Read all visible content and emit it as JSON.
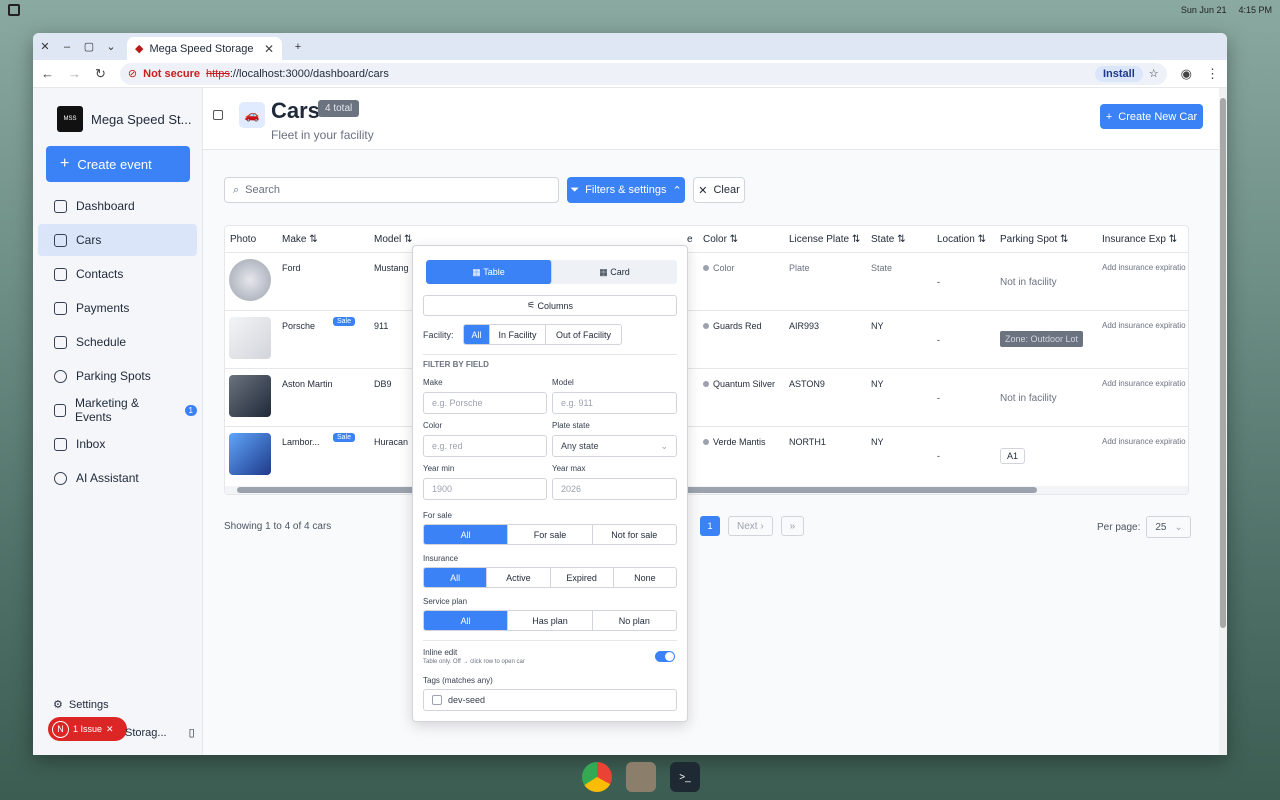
{
  "desktop": {
    "date": "Sun Jun 21",
    "time": "4:15 PM"
  },
  "browser": {
    "tab_title": "Mega Speed Storage",
    "not_secure": "Not secure",
    "url_scheme": "https",
    "url_rest": "://localhost:3000/dashboard/cars",
    "install": "Install"
  },
  "sidebar": {
    "brand": "Mega Speed St...",
    "create_event": "Create event",
    "items": [
      {
        "label": "Dashboard"
      },
      {
        "label": "Cars"
      },
      {
        "label": "Contacts"
      },
      {
        "label": "Payments"
      },
      {
        "label": "Schedule"
      },
      {
        "label": "Parking Spots"
      },
      {
        "label": "Marketing & Events",
        "badge": "1"
      },
      {
        "label": "Inbox"
      },
      {
        "label": "AI Assistant"
      }
    ],
    "settings": "Settings",
    "issue_initial": "N",
    "issue_label": "1 Issue",
    "footer_label": "Storag..."
  },
  "header": {
    "title": "Cars",
    "total": "4 total",
    "subtitle": "Fleet in your facility",
    "new_car": "Create New Car"
  },
  "toolbar": {
    "search_placeholder": "Search",
    "filters": "Filters & settings",
    "clear": "Clear"
  },
  "table": {
    "headers": {
      "photo": "Photo",
      "make": "Make",
      "model": "Model",
      "e": "e",
      "color": "Color",
      "plate": "License Plate",
      "state": "State",
      "location": "Location",
      "parking": "Parking Spot",
      "insurance": "Insurance Exp"
    },
    "sale_label": "Sale",
    "rows": [
      {
        "make": "Ford",
        "model": "Mustang",
        "color": "Color",
        "plate": "Plate",
        "state": "State",
        "location": "-",
        "parking": "Not in facility",
        "insurance": "Add insurance expiratio"
      },
      {
        "make": "Porsche",
        "model": "911",
        "color": "Guards Red",
        "plate": "AIR993",
        "state": "NY",
        "location": "-",
        "parking": "Zone: Outdoor Lot",
        "insurance": "Add insurance expiratio"
      },
      {
        "make": "Aston Martin",
        "model": "DB9",
        "color": "Quantum Silver",
        "plate": "ASTON9",
        "state": "NY",
        "location": "-",
        "parking": "Not in facility",
        "insurance": "Add insurance expiratio"
      },
      {
        "make": "Lambor...",
        "model": "Huracan",
        "color": "Verde Mantis",
        "plate": "NORTH1",
        "state": "NY",
        "location": "-",
        "parking": "A1",
        "insurance": "Add insurance expiratio"
      }
    ]
  },
  "footer": {
    "showing": "Showing 1 to 4 of 4 cars",
    "page": "1",
    "next": "Next",
    "per_page_label": "Per page:",
    "per_page": "25"
  },
  "panel": {
    "view_table": "Table",
    "view_card": "Card",
    "columns": "Columns",
    "facility_label": "Facility:",
    "facility_all": "All",
    "facility_in": "In Facility",
    "facility_out": "Out of Facility",
    "filter_by_field": "FILTER BY FIELD",
    "make_label": "Make",
    "make_ph": "e.g. Porsche",
    "model_label": "Model",
    "model_ph": "e.g. 911",
    "color_label": "Color",
    "color_ph": "e.g. red",
    "plate_state_label": "Plate state",
    "plate_state_value": "Any state",
    "year_min_label": "Year min",
    "year_min_ph": "1900",
    "year_max_label": "Year max",
    "year_max_ph": "2026",
    "for_sale_label": "For sale",
    "for_sale_opts": [
      "All",
      "For sale",
      "Not for sale"
    ],
    "insurance_label": "Insurance",
    "insurance_opts": [
      "All",
      "Active",
      "Expired",
      "None"
    ],
    "service_label": "Service plan",
    "service_opts": [
      "All",
      "Has plan",
      "No plan"
    ],
    "inline_edit": "Inline edit",
    "inline_hint": "Table only. Off → click row to open car",
    "tags_label": "Tags (matches any)",
    "tag": "dev-seed"
  },
  "colors": {
    "accent": "#3b82f6"
  }
}
